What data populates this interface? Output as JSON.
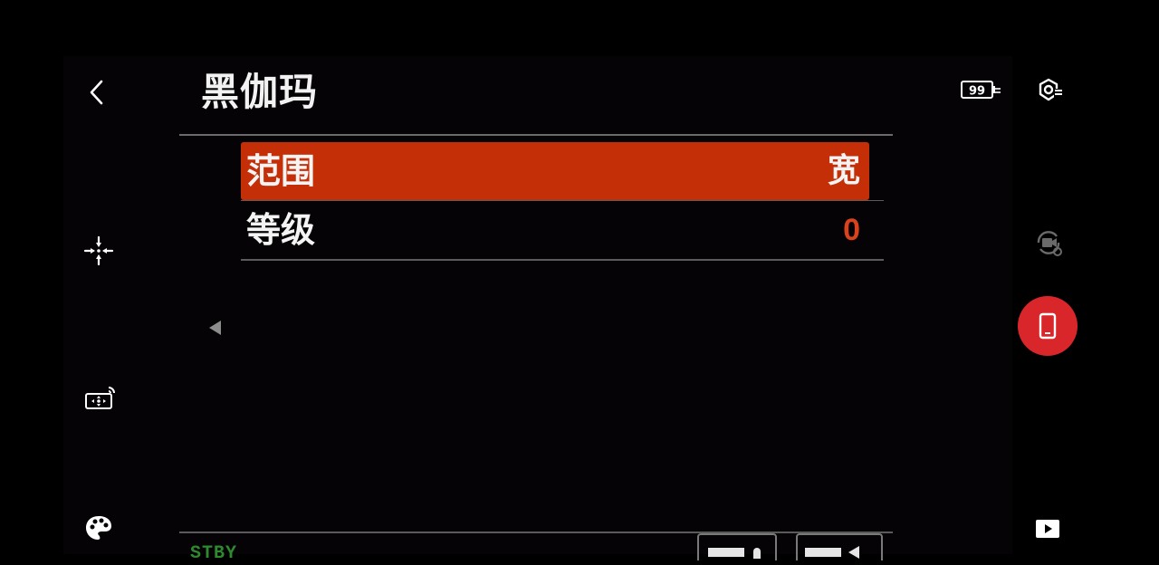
{
  "header": {
    "title": "黑伽玛",
    "battery_level": "99"
  },
  "menu": {
    "items": [
      {
        "label": "范围",
        "value": "宽"
      },
      {
        "label": "等级",
        "value": "0"
      }
    ]
  },
  "status": {
    "mode_text": "STBY"
  },
  "colors": {
    "selected_row": "#c42f07",
    "record_button": "#d9262b",
    "value_accent": "#d8431e",
    "status_text": "#2f8a2f"
  },
  "icons": {
    "back": "back-arrow-icon",
    "focus": "focus-cross-icon",
    "cast": "screen-cast-icon",
    "palette": "palette-icon",
    "battery": "battery-icon",
    "settings": "gear-settings-icon",
    "switch_camera": "switch-camera-icon",
    "phone": "phone-icon",
    "play": "play-icon",
    "page_left": "triangle-left-icon"
  }
}
